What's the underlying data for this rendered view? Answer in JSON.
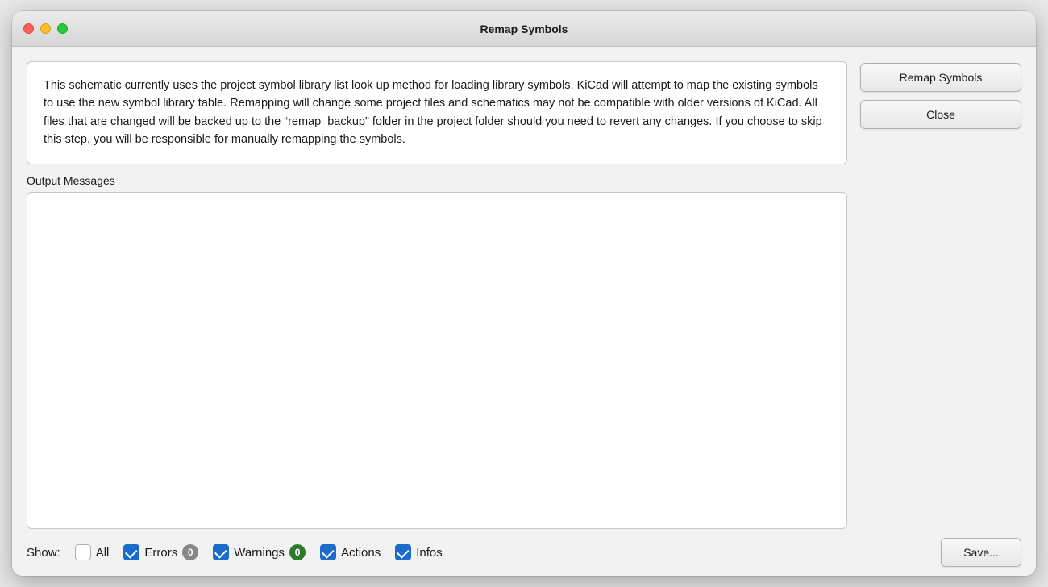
{
  "window": {
    "title": "Remap Symbols"
  },
  "titlebar": {
    "title": "Remap Symbols"
  },
  "traffic_lights": {
    "close_label": "close",
    "minimize_label": "minimize",
    "maximize_label": "maximize"
  },
  "info_box": {
    "text": "This schematic currently uses the project symbol library list look up method for loading library symbols. KiCad will attempt to map the existing symbols to use the new symbol library table. Remapping will change some project files and schematics may not be compatible with older versions of KiCad. All files that are changed will be backed up to the “remap_backup” folder in the project folder should you need to revert any changes. If you choose to skip this step, you will be responsible for manually remapping the symbols."
  },
  "output": {
    "label": "Output Messages",
    "content": ""
  },
  "right_buttons": {
    "remap_label": "Remap Symbols",
    "close_label": "Close"
  },
  "bottom_bar": {
    "show_label": "Show:",
    "all_label": "All",
    "all_checked": false,
    "errors_label": "Errors",
    "errors_checked": true,
    "errors_count": "0",
    "warnings_label": "Warnings",
    "warnings_checked": true,
    "warnings_count": "0",
    "actions_label": "Actions",
    "actions_checked": true,
    "infos_label": "Infos",
    "infos_checked": true,
    "save_label": "Save..."
  },
  "colors": {
    "badge_errors": "#888888",
    "badge_warnings": "#2d7a2d",
    "checkbox_checked": "#1a6bcc",
    "checkbox_unchecked": "#ffffff"
  }
}
